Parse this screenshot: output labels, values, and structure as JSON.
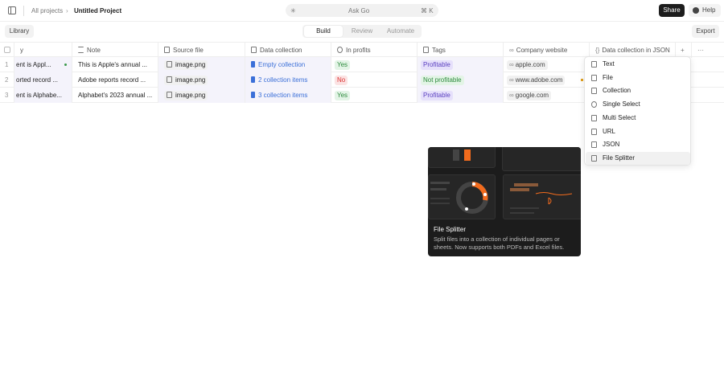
{
  "breadcrumb": {
    "root": "All projects",
    "current": "Untitled Project"
  },
  "ask": {
    "label": "Ask Go",
    "shortcut": "⌘ K"
  },
  "header": {
    "share": "Share",
    "help": "Help"
  },
  "toolbar": {
    "library": "Library",
    "export": "Export",
    "tabs": [
      "Build",
      "Review",
      "Automate"
    ]
  },
  "columns": [
    "y",
    "Note",
    "Source file",
    "Data collection",
    "In profits",
    "Tags",
    "Company website",
    "Data collection in JSON"
  ],
  "rows": [
    {
      "n": "1",
      "name": "ent is Appl...",
      "note": "This is Apple's annual ...",
      "file": "image.png",
      "collection": "Empty collection",
      "profit": "Yes",
      "tag": "Profitable",
      "site": "apple.com"
    },
    {
      "n": "2",
      "name": "orted record ...",
      "note": "Adobe reports record ...",
      "file": "image.png",
      "collection": "2 collection items",
      "profit": "No",
      "tag": "Not profitable",
      "site": "www.adobe.com"
    },
    {
      "n": "3",
      "name": "ent is Alphabe...",
      "note": "Alphabet's 2023 annual ...",
      "file": "image.png",
      "collection": "3 collection items",
      "profit": "Yes",
      "tag": "Profitable",
      "site": "google.com"
    }
  ],
  "menu": [
    "Text",
    "File",
    "Collection",
    "Single Select",
    "Multi Select",
    "URL",
    "JSON",
    "File Splitter"
  ],
  "tooltip": {
    "title": "File Splitter",
    "desc": "Split files into a collection of individual pages or sheets. Now supports both PDFs and Excel files."
  },
  "colors": {
    "accent": "#f26b1d",
    "link": "#3a6fd8",
    "yes": "#2e8b3e",
    "no": "#d33",
    "tag": "#5a3fc0"
  }
}
